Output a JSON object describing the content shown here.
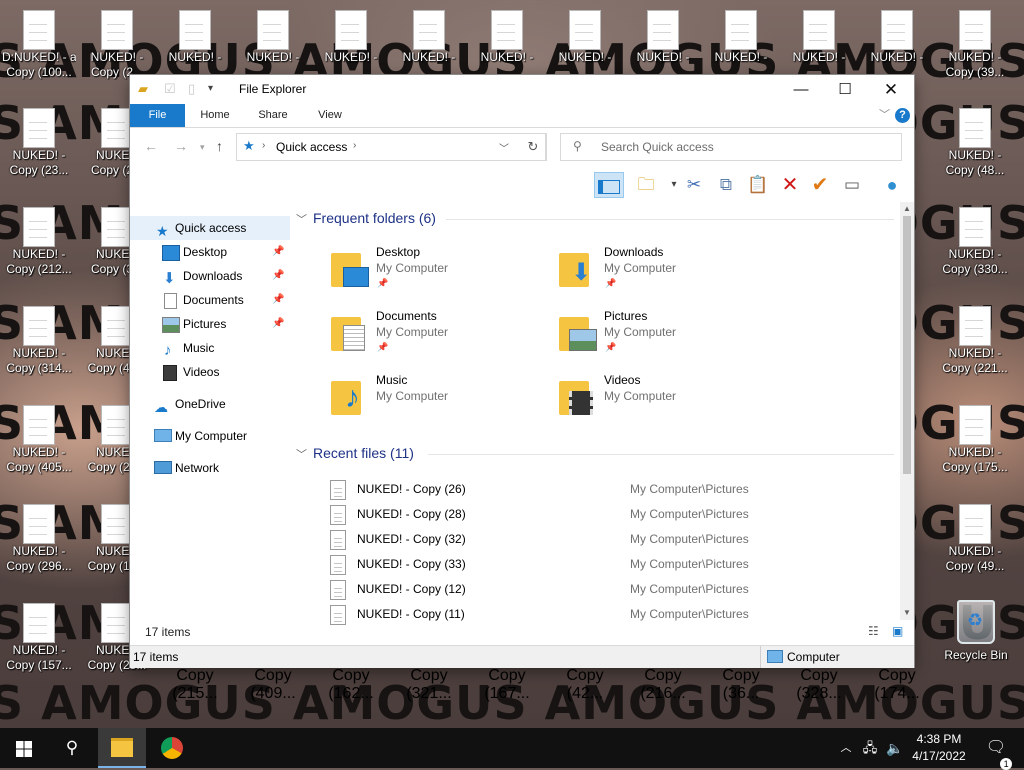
{
  "desktop": {
    "watermark_text": "S AMOGUS AMOGUS AMOGUS AMOGUS AMOGUS AMOGUS",
    "row1_icons": [
      {
        "line1": "D:NUKED! - ar",
        "line2": "Copy (100..."
      },
      {
        "line1": "NUKED! -",
        "line2": "Copy (2..."
      },
      {
        "line1": "NUKED! -",
        "line2": ""
      },
      {
        "line1": "NUKED! -",
        "line2": ""
      },
      {
        "line1": "NUKED! -",
        "line2": ""
      },
      {
        "line1": "NUKED! -",
        "line2": ""
      },
      {
        "line1": "NUKED! -",
        "line2": ""
      },
      {
        "line1": "NUKED! -",
        "line2": ""
      },
      {
        "line1": "NUKED! -",
        "line2": ""
      },
      {
        "line1": "NUKED! -",
        "line2": ""
      },
      {
        "line1": "NUKED! -",
        "line2": ""
      },
      {
        "line1": "NUKED! -",
        "line2": ""
      },
      {
        "line1": "NUKED! -",
        "line2": "Copy (39..."
      }
    ],
    "left_col1": [
      {
        "line1": "NUKED! -",
        "line2": "Copy (23..."
      },
      {
        "line1": "NUKED! -",
        "line2": "Copy (212..."
      },
      {
        "line1": "NUKED! -",
        "line2": "Copy (314..."
      },
      {
        "line1": "NUKED! -",
        "line2": "Copy (405..."
      },
      {
        "line1": "NUKED! -",
        "line2": "Copy (296..."
      },
      {
        "line1": "NUKED! -",
        "line2": "Copy (157..."
      }
    ],
    "left_col2": [
      {
        "line1": "NUKED",
        "line2": "Copy (2..."
      },
      {
        "line1": "NUKED",
        "line2": "Copy (3..."
      },
      {
        "line1": "NUKED",
        "line2": "Copy (40..."
      },
      {
        "line1": "NUKED",
        "line2": "Copy (29..."
      },
      {
        "line1": "NUKED",
        "line2": "Copy (15..."
      },
      {
        "line1": "NUKED",
        "line2": "Copy (25..."
      }
    ],
    "right_col": [
      {
        "line1": "NUKED! -",
        "line2": "Copy (48..."
      },
      {
        "line1": "NUKED! -",
        "line2": "Copy (330..."
      },
      {
        "line1": "NUKED! -",
        "line2": "Copy (221..."
      },
      {
        "line1": "NUKED! -",
        "line2": "Copy (175..."
      },
      {
        "line1": "NUKED! -",
        "line2": "Copy (49..."
      }
    ],
    "bottom_row": [
      "Copy (215...",
      "Copy (409...",
      "Copy (162...",
      "Copy (321...",
      "Copy (167...",
      "Copy (42...",
      "Copy (216...",
      "Copy (36...",
      "Copy (328...",
      "Copy (174..."
    ],
    "recycle_bin_label": "Recycle Bin"
  },
  "window": {
    "title": "File Explorer",
    "tabs": [
      "File",
      "Home",
      "Share",
      "View"
    ],
    "address_crumb": "Quick access",
    "search_placeholder": "Search Quick access",
    "help_glyph": "?"
  },
  "nav_pane": {
    "quick_access": "Quick access",
    "pinned": [
      "Desktop",
      "Downloads",
      "Documents",
      "Pictures"
    ],
    "unpinned": [
      "Music",
      "Videos"
    ],
    "onedrive": "OneDrive",
    "my_computer": "My Computer",
    "network": "Network"
  },
  "frequent": {
    "heading": "Frequent folders (6)",
    "folders": [
      {
        "name": "Desktop",
        "location": "My Computer",
        "pinned": true
      },
      {
        "name": "Downloads",
        "location": "My Computer",
        "pinned": true
      },
      {
        "name": "Documents",
        "location": "My Computer",
        "pinned": true
      },
      {
        "name": "Pictures",
        "location": "My Computer",
        "pinned": true
      },
      {
        "name": "Music",
        "location": "My Computer",
        "pinned": false
      },
      {
        "name": "Videos",
        "location": "My Computer",
        "pinned": false
      }
    ]
  },
  "recent": {
    "heading": "Recent files (11)",
    "files": [
      {
        "name": "NUKED! - Copy (26)",
        "path": "My Computer\\Pictures"
      },
      {
        "name": "NUKED! - Copy (28)",
        "path": "My Computer\\Pictures"
      },
      {
        "name": "NUKED! - Copy (32)",
        "path": "My Computer\\Pictures"
      },
      {
        "name": "NUKED! - Copy (33)",
        "path": "My Computer\\Pictures"
      },
      {
        "name": "NUKED! - Copy (12)",
        "path": "My Computer\\Pictures"
      },
      {
        "name": "NUKED! - Copy (11)",
        "path": "My Computer\\Pictures"
      }
    ]
  },
  "status": {
    "items": "17 items",
    "bottom_items": "17 items",
    "bottom_location": "Computer"
  },
  "taskbar": {
    "time": "4:38 PM",
    "date": "4/17/2022",
    "notification_count": "1"
  },
  "colors": {
    "accent": "#1979ca",
    "heading": "#1e3287",
    "folder": "#f5c542",
    "taskbar": "#111111"
  }
}
